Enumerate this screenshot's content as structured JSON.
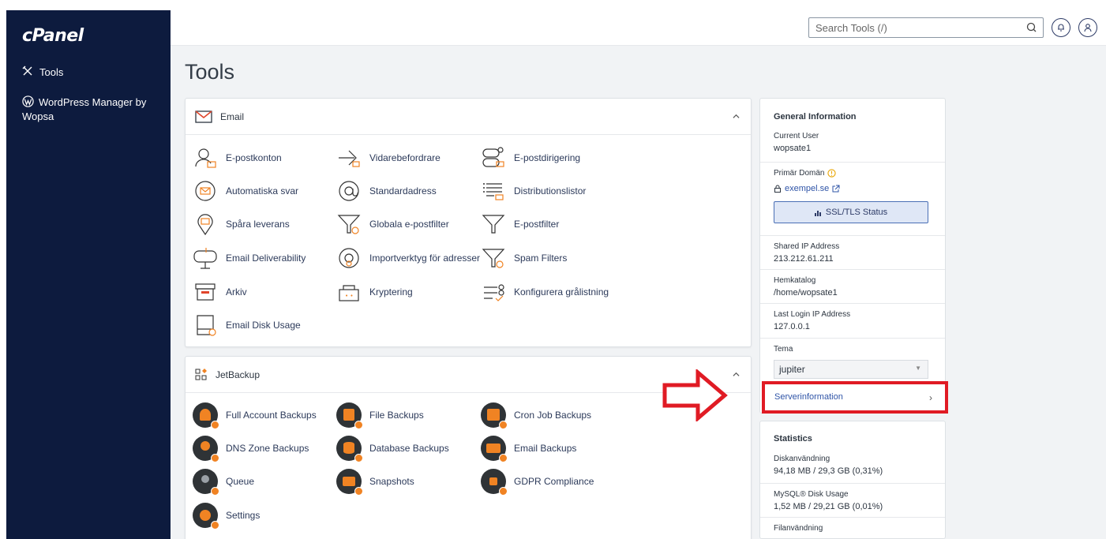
{
  "sidebar": {
    "logo": "cPanel",
    "items": [
      {
        "label": "Tools",
        "icon": "tools-icon"
      },
      {
        "label": "WordPress Manager by Wopsa",
        "icon": "wordpress-icon"
      }
    ]
  },
  "topbar": {
    "search_placeholder": "Search Tools (/)",
    "notifications_icon": "bell-icon",
    "user_icon": "user-icon"
  },
  "page": {
    "title": "Tools"
  },
  "email": {
    "title": "Email",
    "tools": [
      {
        "label": "E-postkonton",
        "icon": "email-accounts-icon"
      },
      {
        "label": "Vidarebefordrare",
        "icon": "forwarders-icon"
      },
      {
        "label": "E-postdirigering",
        "icon": "email-routing-icon"
      },
      {
        "label": "Automatiska svar",
        "icon": "autoresponder-icon"
      },
      {
        "label": "Standardadress",
        "icon": "at-icon"
      },
      {
        "label": "Distributionslistor",
        "icon": "mailing-lists-icon"
      },
      {
        "label": "Spåra leverans",
        "icon": "track-delivery-icon"
      },
      {
        "label": "Globala e-postfilter",
        "icon": "global-filter-icon"
      },
      {
        "label": "E-postfilter",
        "icon": "filter-icon"
      },
      {
        "label": "Email Deliverability",
        "icon": "mailbox-icon"
      },
      {
        "label": "Importverktyg för adresser",
        "icon": "import-icon"
      },
      {
        "label": "Spam Filters",
        "icon": "spam-filter-icon"
      },
      {
        "label": "Arkiv",
        "icon": "archive-icon"
      },
      {
        "label": "Kryptering",
        "icon": "encryption-icon"
      },
      {
        "label": "Konfigurera grålistning",
        "icon": "greylisting-icon"
      },
      {
        "label": "Email Disk Usage",
        "icon": "disk-usage-icon"
      }
    ]
  },
  "jetbackup": {
    "title": "JetBackup",
    "tools": [
      {
        "label": "Full Account Backups",
        "icon": "full-backup-icon"
      },
      {
        "label": "File Backups",
        "icon": "file-backup-icon"
      },
      {
        "label": "Cron Job Backups",
        "icon": "cron-backup-icon"
      },
      {
        "label": "DNS Zone Backups",
        "icon": "dns-backup-icon"
      },
      {
        "label": "Database Backups",
        "icon": "database-backup-icon"
      },
      {
        "label": "Email Backups",
        "icon": "email-backup-icon"
      },
      {
        "label": "Queue",
        "icon": "queue-icon"
      },
      {
        "label": "Snapshots",
        "icon": "snapshot-icon"
      },
      {
        "label": "GDPR Compliance",
        "icon": "gdpr-icon"
      },
      {
        "label": "Settings",
        "icon": "settings-icon"
      }
    ]
  },
  "general_info": {
    "title": "General Information",
    "current_user_label": "Current User",
    "current_user": "wopsate1",
    "primary_domain_label": "Primär Domän",
    "primary_domain": "exempel.se",
    "ssl_button": "SSL/TLS Status",
    "shared_ip_label": "Shared IP Address",
    "shared_ip": "213.212.61.211",
    "home_label": "Hemkatalog",
    "home": "/home/wopsate1",
    "last_login_label": "Last Login IP Address",
    "last_login": "127.0.0.1",
    "theme_label": "Tema",
    "theme": "jupiter",
    "server_info": "Serverinformation"
  },
  "statistics": {
    "title": "Statistics",
    "items": [
      {
        "label": "Diskanvändning",
        "value": "94,18 MB / 29,3 GB  (0,31%)"
      },
      {
        "label": "MySQL® Disk Usage",
        "value": "1,52 MB / 29,21 GB  (0,01%)"
      },
      {
        "label": "Filanvändning",
        "value": ""
      }
    ]
  },
  "colors": {
    "sidebar": "#0d1b3e",
    "highlight": "#e01b24",
    "accent": "#f08323",
    "link": "#2f54a7"
  }
}
